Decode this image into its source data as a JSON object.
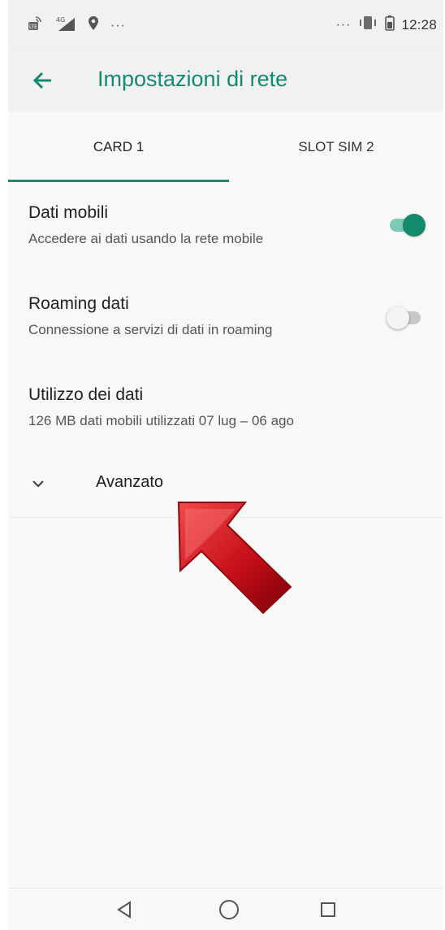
{
  "status_bar": {
    "left_icons": [
      "volte-icon",
      "signal-4g-icon",
      "location-icon"
    ],
    "left_more": "···",
    "right_more": "···",
    "right_icons": [
      "vibrate-icon",
      "battery-icon"
    ],
    "time": "12:28"
  },
  "app_bar": {
    "title": "Impostazioni di rete",
    "back_icon": "arrow-back-icon",
    "accent_color": "#168a6e"
  },
  "tabs": [
    {
      "label": "CARD 1",
      "selected": true
    },
    {
      "label": "SLOT SIM 2",
      "selected": false
    }
  ],
  "settings": {
    "mobile_data": {
      "title": "Dati mobili",
      "subtitle": "Accedere ai dati usando la rete mobile",
      "enabled": true
    },
    "data_roaming": {
      "title": "Roaming dati",
      "subtitle": "Connessione a servizi di dati in roaming",
      "enabled": false
    },
    "data_usage": {
      "title": "Utilizzo dei dati",
      "subtitle": "126 MB dati mobili utilizzati 07 lug – 06 ago"
    },
    "advanced": {
      "title": "Avanzato",
      "icon": "chevron-down-icon"
    }
  },
  "annotation": {
    "icon": "red-arrow-icon",
    "color": "#c8101a"
  },
  "nav_bar": {
    "icons": [
      "nav-back-icon",
      "nav-home-icon",
      "nav-recents-icon"
    ]
  }
}
